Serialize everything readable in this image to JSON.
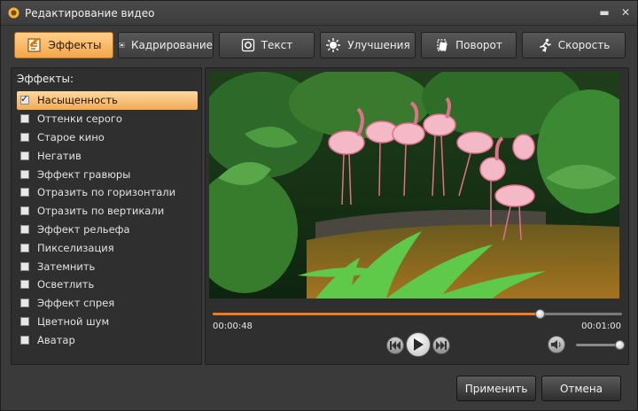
{
  "window": {
    "title": "Редактирование видео"
  },
  "tabs": [
    {
      "label": "Эффекты",
      "icon": "effects-icon",
      "active": true
    },
    {
      "label": "Кадрирование",
      "icon": "crop-icon",
      "active": false
    },
    {
      "label": "Текст",
      "icon": "text-icon",
      "active": false
    },
    {
      "label": "Улучшения",
      "icon": "brightness-icon",
      "active": false
    },
    {
      "label": "Поворот",
      "icon": "rotate-icon",
      "active": false
    },
    {
      "label": "Скорость",
      "icon": "runner-icon",
      "active": false
    }
  ],
  "effects": {
    "title": "Эффекты:",
    "items": [
      {
        "label": "Насыщенность",
        "checked": true
      },
      {
        "label": "Оттенки серого",
        "checked": false
      },
      {
        "label": "Старое кино",
        "checked": false
      },
      {
        "label": "Негатив",
        "checked": false
      },
      {
        "label": "Эффект гравюры",
        "checked": false
      },
      {
        "label": "Отразить по горизонтали",
        "checked": false
      },
      {
        "label": "Отразить по вертикали",
        "checked": false
      },
      {
        "label": "Эффект рельефа",
        "checked": false
      },
      {
        "label": "Пикселизация",
        "checked": false
      },
      {
        "label": "Затемнить",
        "checked": false
      },
      {
        "label": "Осветлить",
        "checked": false
      },
      {
        "label": "Эффект спрея",
        "checked": false
      },
      {
        "label": "Цветной шум",
        "checked": false
      },
      {
        "label": "Аватар",
        "checked": false
      }
    ]
  },
  "player": {
    "current_time": "00:00:48",
    "total_time": "00:01:00",
    "progress": 0.8,
    "volume": 0.95,
    "accent": "#f07a21"
  },
  "footer": {
    "apply_label": "Применить",
    "cancel_label": "Отмена"
  }
}
